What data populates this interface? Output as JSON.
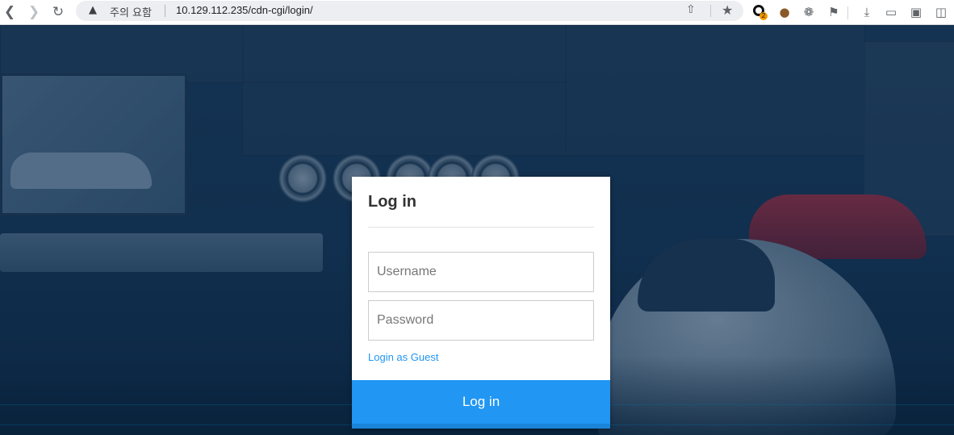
{
  "browser": {
    "back_icon": "chevron-left-icon",
    "forward_icon": "chevron-right-icon",
    "reload_icon": "reload-icon",
    "security_warning": "주의 요함",
    "url": "10.129.112.235/cdn-cgi/login/",
    "extension_badge": "2"
  },
  "login": {
    "title": "Log in",
    "username_placeholder": "Username",
    "password_placeholder": "Password",
    "guest_link": "Login as Guest",
    "submit_label": "Log in"
  },
  "colors": {
    "accent": "#2196f3",
    "background_tint": "#0f2a45"
  }
}
